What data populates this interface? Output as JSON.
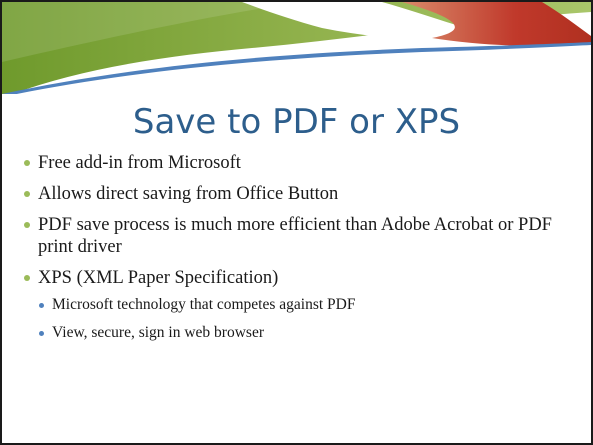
{
  "slide": {
    "title": "Save to PDF or XPS",
    "bullets": [
      {
        "text": "Free add-in from Microsoft",
        "sub": []
      },
      {
        "text": "Allows direct saving from Office Button",
        "sub": []
      },
      {
        "text": "PDF save process is much more efficient than Adobe Acrobat or PDF print driver",
        "sub": []
      },
      {
        "text": "XPS (XML Paper Specification)",
        "sub": [
          "Microsoft technology that competes against PDF",
          "View, secure, sign in web browser"
        ]
      }
    ]
  },
  "colors": {
    "title": "#2d5e8c",
    "bullet_level1": "#9bbb59",
    "bullet_level2": "#4f81bd",
    "swoosh_green": "#8fb04a",
    "swoosh_red": "#c0392b",
    "swoosh_blue": "#4f81bd"
  }
}
